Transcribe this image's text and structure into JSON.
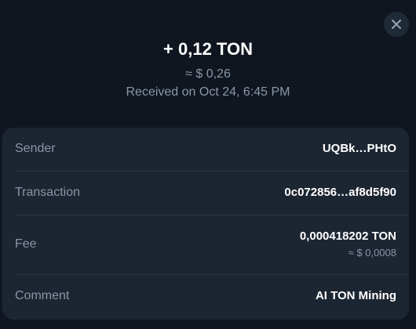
{
  "header": {
    "amount": "+ 0,12 TON",
    "fiat": "≈ $ 0,26",
    "received": "Received on Oct 24, 6:45 PM"
  },
  "icons": {
    "close": "close-icon"
  },
  "details": {
    "sender": {
      "label": "Sender",
      "value": "UQBk…PHtO"
    },
    "transaction": {
      "label": "Transaction",
      "value": "0c072856…af8d5f90"
    },
    "fee": {
      "label": "Fee",
      "value": "0,000418202 TON",
      "fiat": "≈ $ 0,0008"
    },
    "comment": {
      "label": "Comment",
      "value": "AI TON Mining"
    }
  },
  "colors": {
    "background": "#10161f",
    "card": "#1c2532",
    "muted_text": "#8a96a6",
    "primary_text": "#ffffff"
  }
}
